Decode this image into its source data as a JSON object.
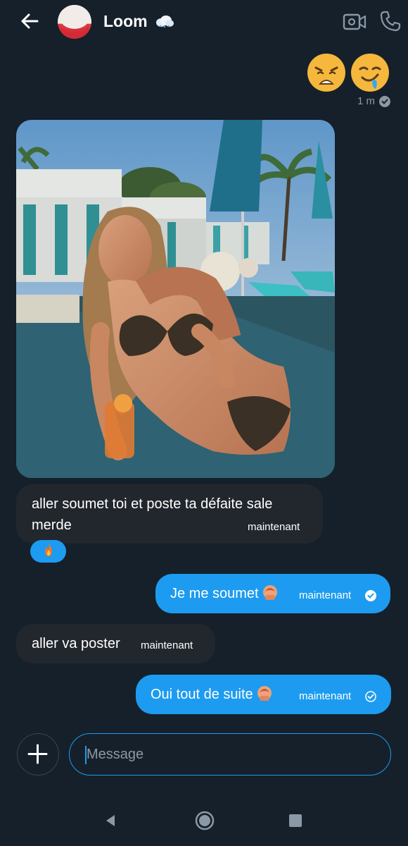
{
  "header": {
    "contact_name": "Loom",
    "status_emoji": "☁",
    "icons": [
      "back-arrow-icon",
      "avatar",
      "video-call-icon",
      "phone-icon"
    ]
  },
  "messages": [
    {
      "id": "top",
      "direction": "out",
      "text": "😩🤤",
      "time": "1 m",
      "status": "seen"
    },
    {
      "id": "photo",
      "direction": "in",
      "type": "image"
    },
    {
      "id": "m1",
      "direction": "in",
      "lines": [
        "aller soumet toi et poste ta défaite sale",
        "merde"
      ],
      "time": "maintenant",
      "reaction": "🔥"
    },
    {
      "id": "m2",
      "direction": "out",
      "text": "Je me soumet",
      "emoji": "🙇",
      "time": "maintenant",
      "status": "sent"
    },
    {
      "id": "m3",
      "direction": "in",
      "text": "aller va poster",
      "time": "maintenant"
    },
    {
      "id": "m4",
      "direction": "out",
      "text": "Oui tout de suite",
      "emoji": "🙇",
      "time": "maintenant",
      "status": "sent"
    }
  ],
  "composer": {
    "placeholder": "Message"
  },
  "colors": {
    "background": "#15202b",
    "accent": "#1d9bf0",
    "incoming_bubble": "#22272e",
    "muted_text": "#8b98a5"
  }
}
